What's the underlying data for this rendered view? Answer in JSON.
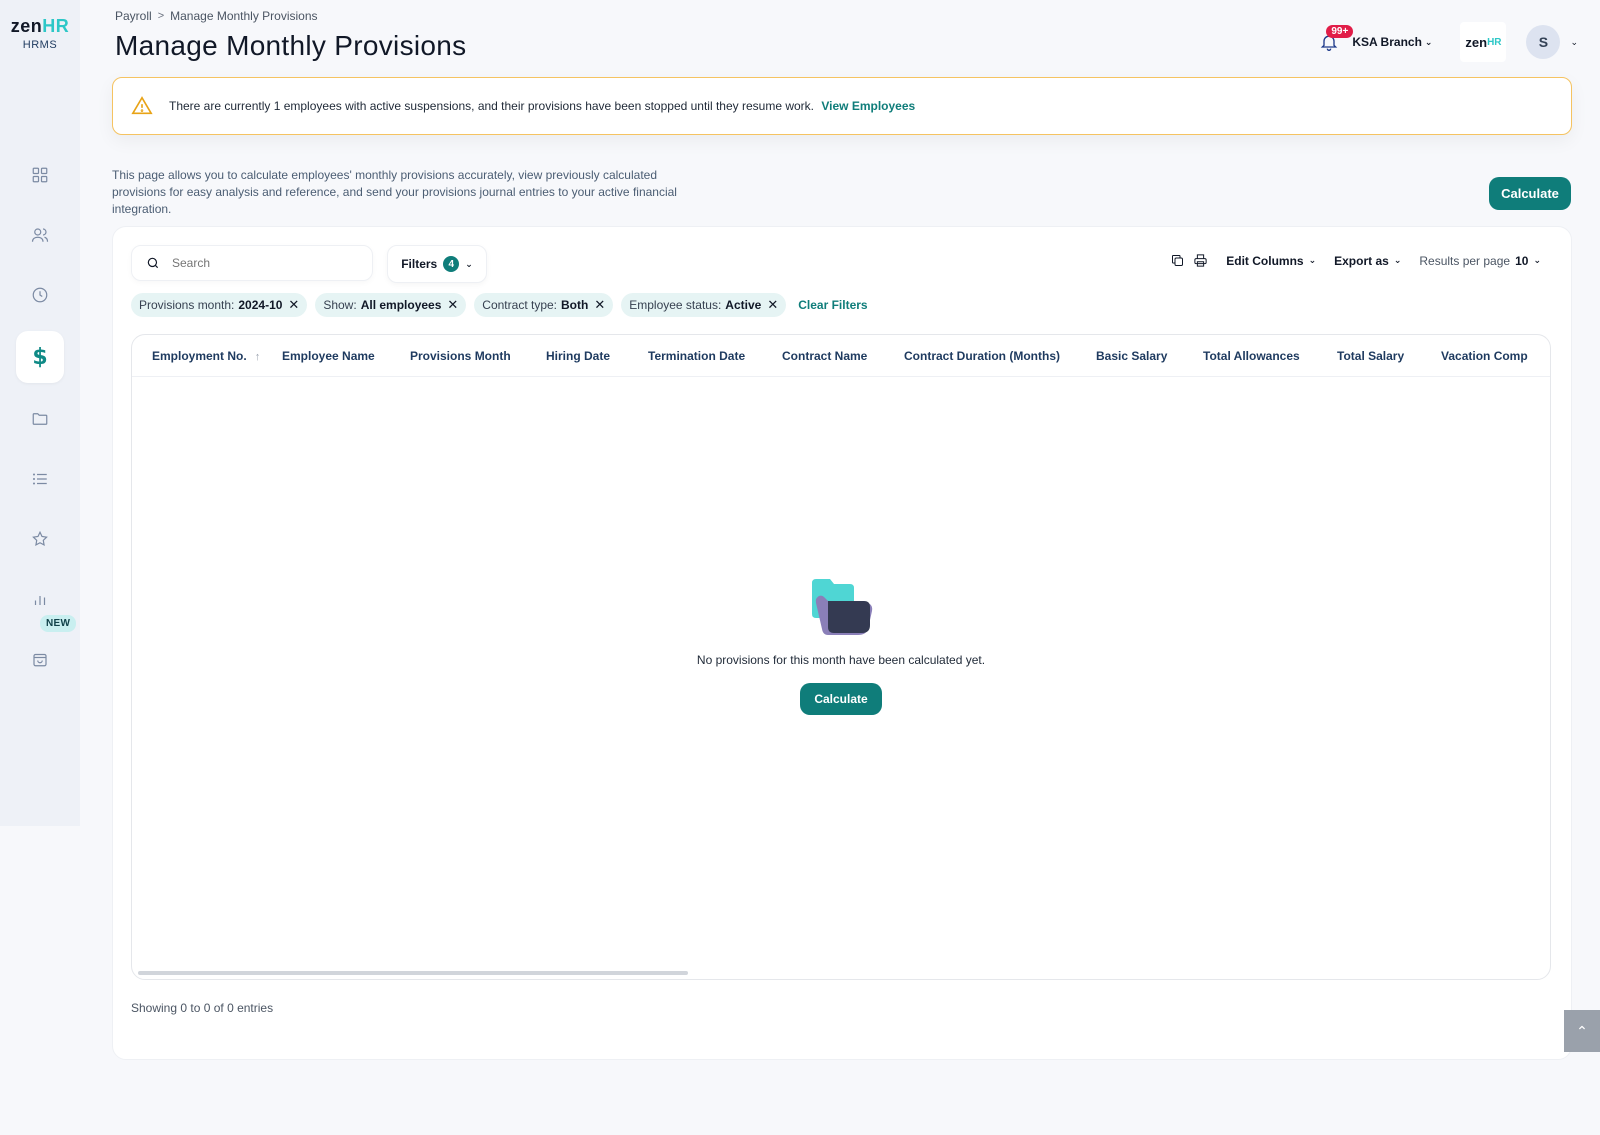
{
  "app": {
    "logo_main": "zen",
    "logo_accent": "HR",
    "logo_sub": "HRMS"
  },
  "sidebar": {
    "items": [
      {
        "icon": "grid-icon"
      },
      {
        "icon": "users-icon"
      },
      {
        "icon": "clock-icon"
      },
      {
        "icon": "dollar-icon",
        "symbol": "$",
        "active": true
      },
      {
        "icon": "folder-icon"
      },
      {
        "icon": "list-icon"
      },
      {
        "icon": "star-icon"
      },
      {
        "icon": "bar-chart-icon"
      },
      {
        "icon": "bag-icon",
        "badge": "NEW"
      }
    ]
  },
  "header": {
    "breadcrumb": {
      "parent": "Payroll",
      "separator": ">",
      "current": "Manage Monthly Provisions"
    },
    "title": "Manage Monthly Provisions",
    "notifications_badge": "99+",
    "branch": "KSA Branch",
    "company_logo_main": "zen",
    "company_logo_accent": "HR",
    "avatar_initial": "S"
  },
  "alert": {
    "text": "There are currently 1 employees with active suspensions, and their provisions have been stopped until they resume work.",
    "link": "View Employees"
  },
  "description": "This page allows you to calculate employees' monthly provisions accurately, view previously calculated provisions for easy analysis and reference, and send your provisions journal entries to your active financial integration.",
  "calculate_label": "Calculate",
  "toolbar": {
    "search_placeholder": "Search",
    "filters_label": "Filters",
    "filters_count": "4",
    "edit_columns": "Edit Columns",
    "export_as": "Export as",
    "results_per_page_label": "Results per page",
    "results_per_page_value": "10"
  },
  "chips": [
    {
      "label": "Provisions month:",
      "value": "2024-10"
    },
    {
      "label": "Show:",
      "value": "All employees"
    },
    {
      "label": "Contract type:",
      "value": "Both"
    },
    {
      "label": "Employee status:",
      "value": "Active"
    }
  ],
  "clear_filters": "Clear Filters",
  "table": {
    "columns": [
      "Employment No.",
      "Employee Name",
      "Provisions Month",
      "Hiring Date",
      "Termination Date",
      "Contract Name",
      "Contract Duration (Months)",
      "Basic Salary",
      "Total Allowances",
      "Total Salary",
      "Vacation Comp"
    ],
    "rows": []
  },
  "empty_state": {
    "message": "No provisions for this month have been calculated yet.",
    "button": "Calculate"
  },
  "footer": {
    "showing": "Showing 0 to 0 of 0 entries"
  },
  "colors": {
    "primary": "#0f7d7a",
    "alert_border": "#f5c361",
    "badge_red": "#e11d48",
    "chip_bg": "#e6f4f4"
  }
}
